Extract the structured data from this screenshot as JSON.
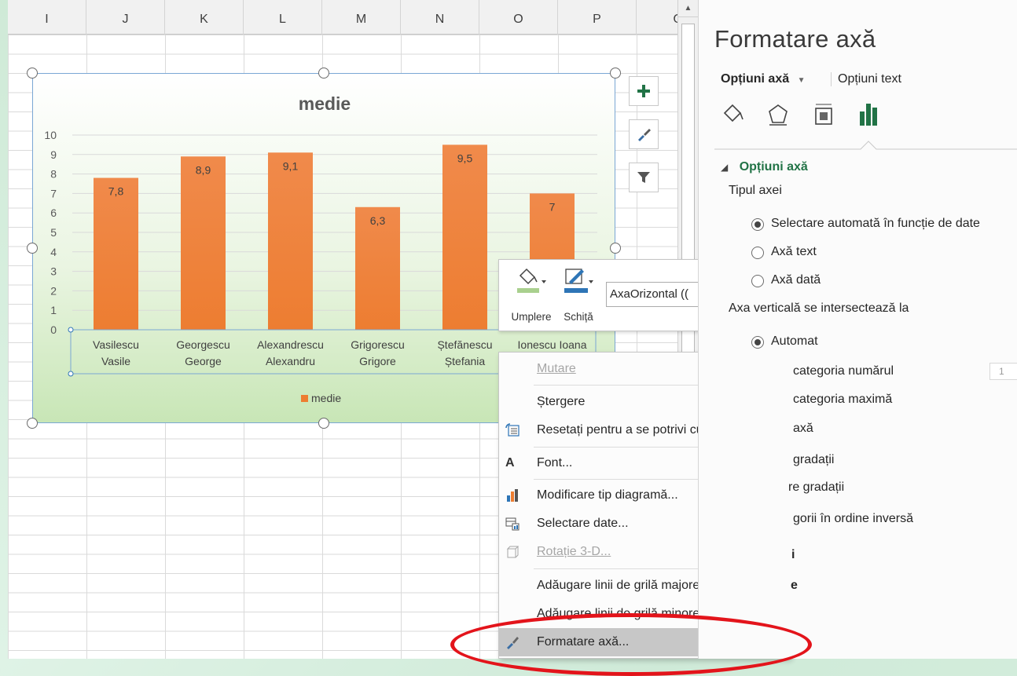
{
  "sheet": {
    "columns": [
      "I",
      "J",
      "K",
      "L",
      "M",
      "N",
      "O",
      "P",
      "Q"
    ]
  },
  "chart_data": {
    "type": "bar",
    "title": "medie",
    "categories": [
      "Vasilescu Vasile",
      "Georgescu George",
      "Alexandrescu Alexandru",
      "Grigorescu Grigore",
      "Ștefănescu Ștefania",
      "Ionescu Ioana"
    ],
    "category_lines": [
      [
        "Vasilescu",
        "Vasile"
      ],
      [
        "Georgescu",
        "George"
      ],
      [
        "Alexandrescu",
        "Alexandru"
      ],
      [
        "Grigorescu",
        "Grigore"
      ],
      [
        "Ștefănescu",
        "Ștefania"
      ],
      [
        "Ionescu Ioana",
        ""
      ]
    ],
    "series": [
      {
        "name": "medie",
        "values": [
          7.8,
          8.9,
          9.1,
          6.3,
          9.5,
          7
        ],
        "labels": [
          "7,8",
          "8,9",
          "9,1",
          "6,3",
          "9,5",
          "7"
        ]
      }
    ],
    "y_ticks": [
      "0",
      "1",
      "2",
      "3",
      "4",
      "5",
      "6",
      "7",
      "8",
      "9",
      "10"
    ],
    "ylim": [
      0,
      10
    ],
    "grid": true,
    "legend_position": "bottom",
    "bar_color": "#ed7d31"
  },
  "mini_toolbar": {
    "fill_label": "Umplere",
    "outline_label": "Schiță",
    "element_value": "AxaOrizontal (("
  },
  "context_menu": {
    "items": [
      {
        "label": "Mutare",
        "disabled": true,
        "submenu": true
      },
      {
        "label": "Ștergere"
      },
      {
        "label": "Resetați pentru a se potrivi cu stilul"
      },
      {
        "label": "Font..."
      },
      {
        "label": "Modificare tip diagramă..."
      },
      {
        "label": "Selectare date..."
      },
      {
        "label": "Rotație 3-D...",
        "disabled": true
      },
      {
        "label": "Adăugare linii de grilă majore"
      },
      {
        "label": "Adăugare linii de grilă minore"
      },
      {
        "label": "Formatare axă...",
        "highlighted": true
      }
    ]
  },
  "pane": {
    "title": "Formatare axă",
    "tab_axis": "Opțiuni axă",
    "tab_text": "Opțiuni text",
    "section": "Opțiuni axă",
    "axis_type_label": "Tipul axei",
    "opt_auto": "Selectare automată în funcție de date",
    "opt_text_axis": "Axă text",
    "opt_date_axis": "Axă dată",
    "intersect_label": "Axa verticală se intersectează la",
    "opt_automat": "Automat",
    "opt_category_number": "categoria numărul",
    "category_number_value": "1",
    "opt_max_category": "categoria maximă",
    "partial_axa": "axă",
    "partial_gradatii1": "gradații",
    "partial_gradatii2": "re gradații",
    "partial_reverse": "gorii în ordine inversă",
    "partial_i": "i",
    "partial_e": "e"
  },
  "colors": {
    "accent_green": "#217346",
    "annotation_red": "#e3141b"
  }
}
